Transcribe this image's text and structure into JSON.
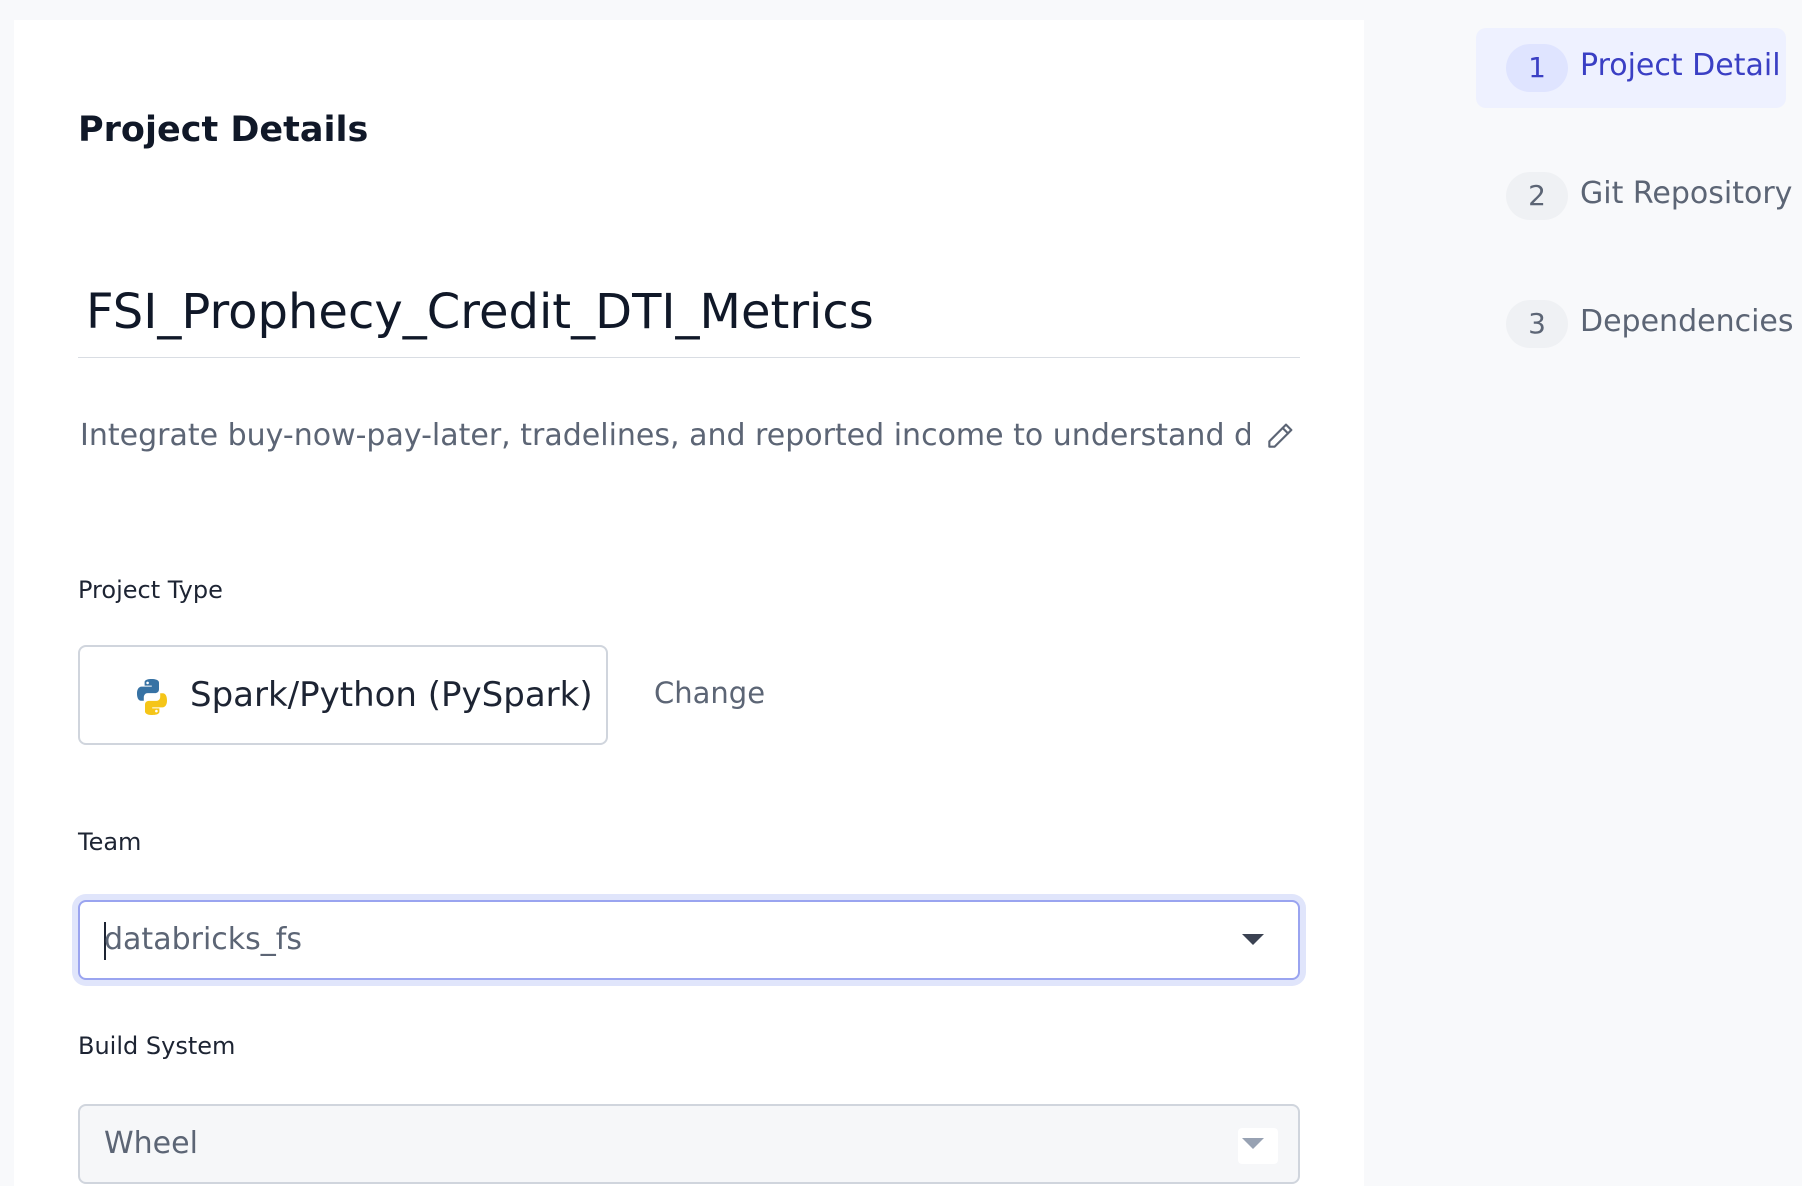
{
  "form": {
    "section_title": "Project Details",
    "project_name": "FSI_Prophecy_Credit_DTI_Metrics",
    "description": "Integrate buy-now-pay-later, tradelines, and reported income to understand defaul",
    "project_type": {
      "label": "Project Type",
      "value": "Spark/Python (PySpark)",
      "icon": "python-logo-icon",
      "change_label": "Change"
    },
    "team": {
      "label": "Team",
      "value": "databricks_fs"
    },
    "build_system": {
      "label": "Build System",
      "value": "Wheel"
    }
  },
  "stepper": {
    "steps": [
      {
        "number": "1",
        "label": "Project Detail",
        "active": true
      },
      {
        "number": "2",
        "label": "Git Repository",
        "active": false
      },
      {
        "number": "3",
        "label": "Dependencies",
        "active": false
      }
    ]
  },
  "colors": {
    "accent": "#3a3fc4",
    "accent_bg": "#eef1ff",
    "focus_ring": "#e0e5fb",
    "text_primary": "#101828",
    "text_muted": "#5c6575"
  }
}
